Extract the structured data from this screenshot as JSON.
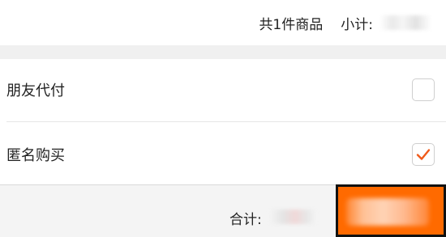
{
  "summary": {
    "item_count_text": "共1件商品",
    "subtotal_label": "小计:"
  },
  "options": [
    {
      "label": "朋友代付",
      "checked": false
    },
    {
      "label": "匿名购买",
      "checked": true
    }
  ],
  "footer": {
    "total_label": "合计:"
  },
  "colors": {
    "accent": "#ff6a00",
    "checkmark": "#f05a1a"
  },
  "icons": {
    "checkmark": "checkmark-icon"
  }
}
